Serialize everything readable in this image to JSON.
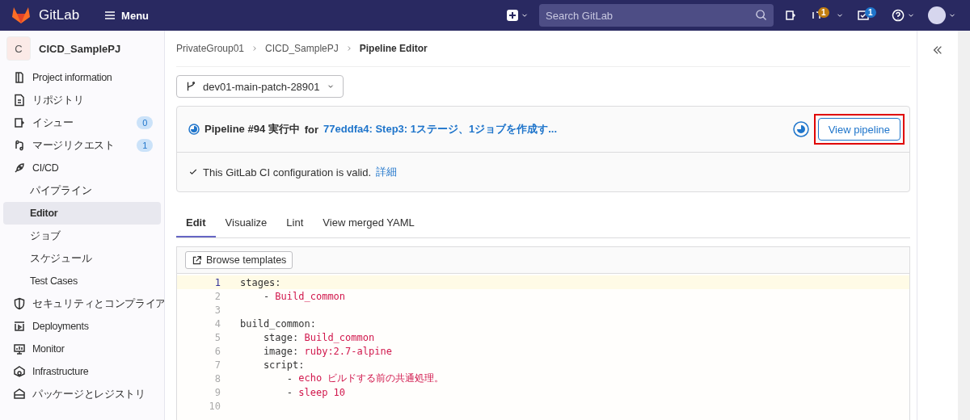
{
  "topbar": {
    "brand": "GitLab",
    "menu": "Menu",
    "search": {
      "placeholder": "Search GitLab"
    },
    "merge_requests_badge": "1",
    "todos_badge": "1"
  },
  "sidebar": {
    "project_initial": "C",
    "project_name": "CICD_SamplePJ",
    "items": [
      {
        "label": "Project information",
        "kind": "section",
        "selected": false
      },
      {
        "label": "リポジトリ",
        "kind": "section",
        "selected": false
      },
      {
        "label": "イシュー",
        "kind": "section",
        "selected": false,
        "count": "0"
      },
      {
        "label": "マージリクエスト",
        "kind": "section",
        "selected": false,
        "count": "1"
      },
      {
        "label": "CI/CD",
        "kind": "section",
        "selected": false
      },
      {
        "label": "パイプライン",
        "kind": "sub",
        "selected": false
      },
      {
        "label": "Editor",
        "kind": "sub",
        "selected": true
      },
      {
        "label": "ジョブ",
        "kind": "sub",
        "selected": false
      },
      {
        "label": "スケジュール",
        "kind": "sub",
        "selected": false
      },
      {
        "label": "Test Cases",
        "kind": "sub",
        "selected": false
      },
      {
        "label": "セキュリティとコンプライア",
        "kind": "section",
        "selected": false
      },
      {
        "label": "Deployments",
        "kind": "section",
        "selected": false
      },
      {
        "label": "Monitor",
        "kind": "section",
        "selected": false
      },
      {
        "label": "Infrastructure",
        "kind": "section",
        "selected": false
      },
      {
        "label": "パッケージとレジストリ",
        "kind": "section",
        "selected": false
      }
    ]
  },
  "breadcrumbs": [
    "PrivateGroup01",
    "CICD_SamplePJ",
    "Pipeline Editor"
  ],
  "branch": "dev01-main-patch-28901",
  "pipeline": {
    "title": "Pipeline #94 実行中",
    "for": "for",
    "commit": "77eddfa4: Step3: 1ステージ、1ジョブを作成す...",
    "button": "View pipeline",
    "highlighted": true
  },
  "validation": {
    "message": "This GitLab CI configuration is valid.",
    "link": "詳細"
  },
  "tabs": [
    {
      "label": "Edit",
      "selected": true
    },
    {
      "label": "Visualize",
      "selected": false
    },
    {
      "label": "Lint",
      "selected": false
    },
    {
      "label": "View merged YAML",
      "selected": false
    }
  ],
  "editor": {
    "browse_button": "Browse templates",
    "lines": [
      {
        "number": "1",
        "text": "stages:",
        "current": true
      },
      {
        "number": "2",
        "text": "    - ",
        "value": "Build_common",
        "current": false
      },
      {
        "number": "3",
        "current": false
      },
      {
        "number": "4",
        "text": "build_common:",
        "current": false
      },
      {
        "number": "5",
        "text": "    stage: ",
        "value": "Build_common",
        "current": false
      },
      {
        "number": "6",
        "text": "    image: ",
        "value": "ruby:2.7-alpine",
        "current": false
      },
      {
        "number": "7",
        "text": "    script:",
        "current": false
      },
      {
        "number": "8",
        "text": "        - ",
        "value": "echo ビルドする前の共通処理。",
        "current": false
      },
      {
        "number": "9",
        "text": "        - ",
        "value": "sleep 10",
        "current": false
      },
      {
        "number": "10",
        "current": false
      }
    ]
  }
}
